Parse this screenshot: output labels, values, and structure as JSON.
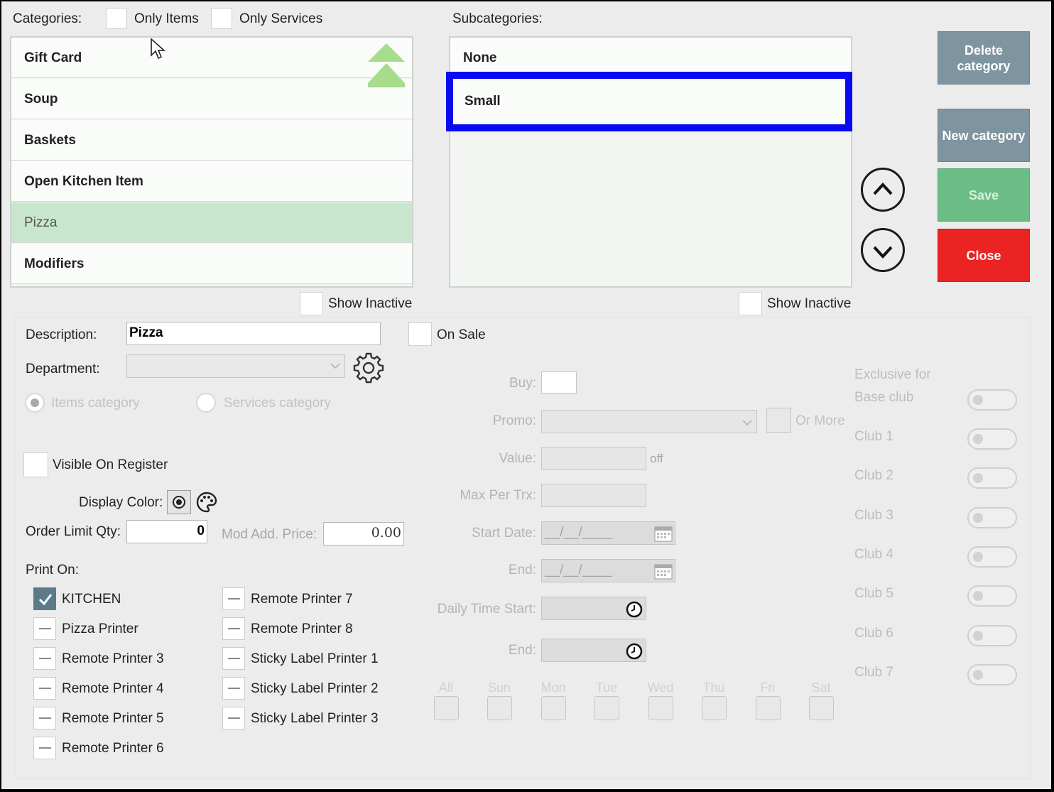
{
  "filters": {
    "categories_label": "Categories:",
    "only_items": "Only Items",
    "only_services": "Only Services"
  },
  "categories": [
    {
      "name": "Gift Card",
      "selected": false
    },
    {
      "name": "Soup",
      "selected": false
    },
    {
      "name": "Baskets",
      "selected": false
    },
    {
      "name": "Open Kitchen Item",
      "selected": false
    },
    {
      "name": "Pizza",
      "selected": true
    },
    {
      "name": "Modifiers",
      "selected": false
    }
  ],
  "subcategories_label": "Subcategories:",
  "subcategories": [
    {
      "name": "None",
      "selected": false
    },
    {
      "name": "Small",
      "selected": true
    }
  ],
  "show_inactive": "Show Inactive",
  "buttons": {
    "delete": "Delete category",
    "new": "New category",
    "save": "Save",
    "close": "Close"
  },
  "colors": {
    "delete_bg": "#7e949e",
    "new_bg": "#7e949e",
    "save_bg": "#6cbd85",
    "close_bg": "#eb2323",
    "selection_border": "#0a0af0",
    "selected_row": "#c8e6cb"
  },
  "form": {
    "description_label": "Description:",
    "description_value": "Pizza",
    "on_sale": "On Sale",
    "department_label": "Department:",
    "department_value": "",
    "items_category": "Items category",
    "services_category": "Services category",
    "visible_on_register": "Visible On Register",
    "display_color_label": "Display Color:",
    "order_limit_label": "Order Limit Qty:",
    "order_limit_value": "0",
    "mod_add_price_label": "Mod Add. Price:",
    "mod_add_price_value": "0.00",
    "print_on_label": "Print On:"
  },
  "printers_left": [
    {
      "name": "KITCHEN",
      "checked": true
    },
    {
      "name": "Pizza Printer",
      "checked": false
    },
    {
      "name": "Remote Printer 3",
      "checked": false
    },
    {
      "name": "Remote Printer 4",
      "checked": false
    },
    {
      "name": "Remote Printer 5",
      "checked": false
    },
    {
      "name": "Remote Printer 6",
      "checked": false
    }
  ],
  "printers_right": [
    {
      "name": "Remote Printer 7",
      "checked": false
    },
    {
      "name": "Remote Printer 8",
      "checked": false
    },
    {
      "name": "Sticky Label Printer 1",
      "checked": false
    },
    {
      "name": "Sticky Label Printer 2",
      "checked": false
    },
    {
      "name": "Sticky Label Printer 3",
      "checked": false
    }
  ],
  "promo": {
    "buy_label": "Buy:",
    "promo_label": "Promo:",
    "or_more": "Or More",
    "value_label": "Value:",
    "off": "off",
    "max_per_trx_label": "Max Per Trx:",
    "start_date_label": "Start Date:",
    "start_date_value": "__/__/____",
    "end_label": "End:",
    "end_date_value": "__/__/____",
    "daily_time_start_label": "Daily Time Start:",
    "time_end_label": "End:",
    "days": [
      "All",
      "Sun",
      "Mon",
      "Tue",
      "Wed",
      "Thu",
      "Fri",
      "Sat"
    ]
  },
  "exclusive": {
    "label_line1": "Exclusive for",
    "clubs": [
      "Base club",
      "Club 1",
      "Club 2",
      "Club 3",
      "Club 4",
      "Club 5",
      "Club 6",
      "Club 7"
    ]
  }
}
